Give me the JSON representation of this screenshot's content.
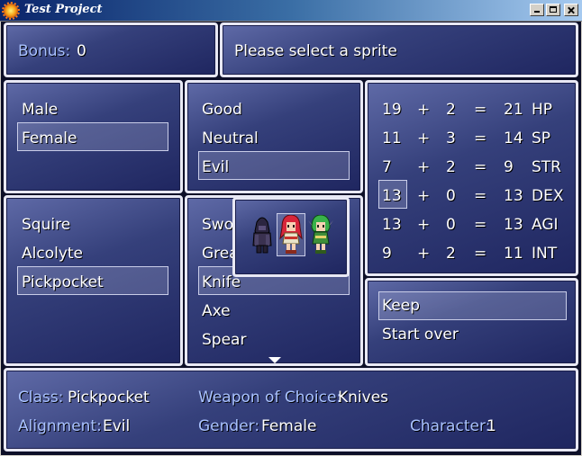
{
  "window": {
    "title": "Test Project"
  },
  "bonus": {
    "label": "Bonus:",
    "value": "0"
  },
  "message": "Please select a sprite",
  "gender": {
    "options": [
      "Male",
      "Female"
    ],
    "selected": 1
  },
  "alignment": {
    "options": [
      "Good",
      "Neutral",
      "Evil"
    ],
    "selected": 2
  },
  "class_menu": {
    "options": [
      "Squire",
      "Alcolyte",
      "Pickpocket"
    ],
    "selected": 2
  },
  "weapon_menu": {
    "options": [
      "Sword",
      "Great",
      "Knife",
      "Axe",
      "Spear"
    ],
    "selected": 2,
    "more_indicator": "down-arrow-icon"
  },
  "sprites": [
    "dark-knight-sprite",
    "red-haired-girl-sprite",
    "green-haired-elf-sprite"
  ],
  "sprite_selected": 1,
  "stats": {
    "plus": "+",
    "equals": "=",
    "rows": [
      {
        "base": "19",
        "bonus": "2",
        "total": "21",
        "name": "HP"
      },
      {
        "base": "11",
        "bonus": "3",
        "total": "14",
        "name": "SP"
      },
      {
        "base": "7",
        "bonus": "2",
        "total": "9",
        "name": "STR"
      },
      {
        "base": "13",
        "bonus": "0",
        "total": "13",
        "name": "DEX"
      },
      {
        "base": "13",
        "bonus": "0",
        "total": "13",
        "name": "AGI"
      },
      {
        "base": "9",
        "bonus": "2",
        "total": "11",
        "name": "INT"
      }
    ],
    "highlighted_row": 3
  },
  "actions": {
    "options": [
      "Keep",
      "Start over"
    ],
    "selected": 0
  },
  "summary": {
    "class_label": "Class:",
    "class_value": "Pickpocket",
    "weapon_label": "Weapon of Choice:",
    "weapon_value": "Knives",
    "alignment_label": "Alignment:",
    "alignment_value": "Evil",
    "gender_label": "Gender:",
    "gender_value": "Female",
    "character_label": "Character:",
    "character_value": "1"
  },
  "colors": {
    "label": "#a9c2ff",
    "text": "#ffffff",
    "window_top": "#5f6aa7",
    "window_bottom": "#1f2660",
    "border": "#e8e8f4"
  }
}
